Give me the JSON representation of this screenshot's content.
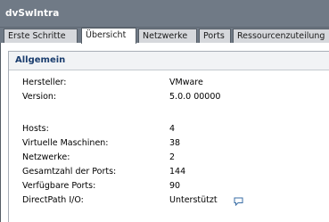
{
  "window": {
    "title": "dvSwIntra"
  },
  "tabs": [
    {
      "label": "Erste Schritte"
    },
    {
      "label": "Übersicht"
    },
    {
      "label": "Netzwerke"
    },
    {
      "label": "Ports"
    },
    {
      "label": "Ressourcenzuteilung"
    }
  ],
  "active_tab": "Übersicht",
  "panel": {
    "title": "Allgemein",
    "rows": [
      {
        "label": "Hersteller:",
        "value": "VMware"
      },
      {
        "label": "Version:",
        "value": "5.0.0 00000"
      },
      {
        "label": "Hosts:",
        "value": "4"
      },
      {
        "label": "Virtuelle Maschinen:",
        "value": "38"
      },
      {
        "label": "Netzwerke:",
        "value": "2"
      },
      {
        "label": "Gesamtzahl der Ports:",
        "value": "144"
      },
      {
        "label": "Verfügbare Ports:",
        "value": "90"
      },
      {
        "label": "DirectPath I/O:",
        "value": "Unterstützt",
        "icon": "speech-bubble-icon"
      }
    ]
  },
  "colors": {
    "titlebar": "#707a86",
    "tab_inactive": "#d6d8dc",
    "tab_active": "#ffffff",
    "panel_title": "#1a3d6e",
    "icon": "#3a6ea5"
  }
}
